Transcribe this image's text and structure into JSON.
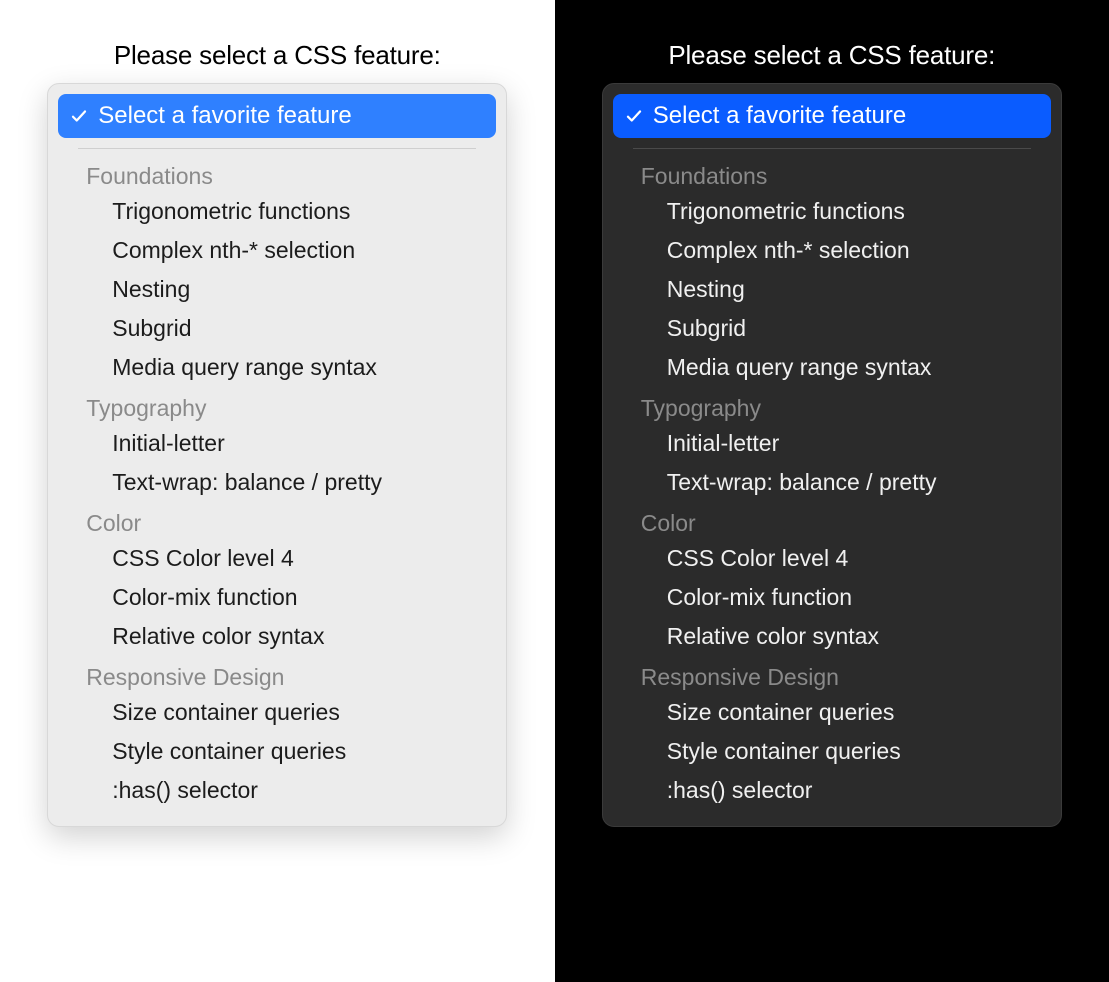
{
  "prompt": "Please select a CSS feature:",
  "selected": {
    "label": "Select a favorite feature",
    "icon": "check"
  },
  "colors": {
    "accent_light": "#2f80ff",
    "accent_dark": "#0a5cff"
  },
  "groups": [
    {
      "label": "Foundations",
      "options": [
        "Trigonometric functions",
        "Complex nth-* selection",
        "Nesting",
        "Subgrid",
        "Media query range syntax"
      ]
    },
    {
      "label": "Typography",
      "options": [
        "Initial-letter",
        "Text-wrap: balance / pretty"
      ]
    },
    {
      "label": "Color",
      "options": [
        "CSS Color level 4",
        "Color-mix function",
        "Relative color syntax"
      ]
    },
    {
      "label": "Responsive Design",
      "options": [
        "Size container queries",
        "Style container queries",
        ":has() selector"
      ]
    }
  ]
}
